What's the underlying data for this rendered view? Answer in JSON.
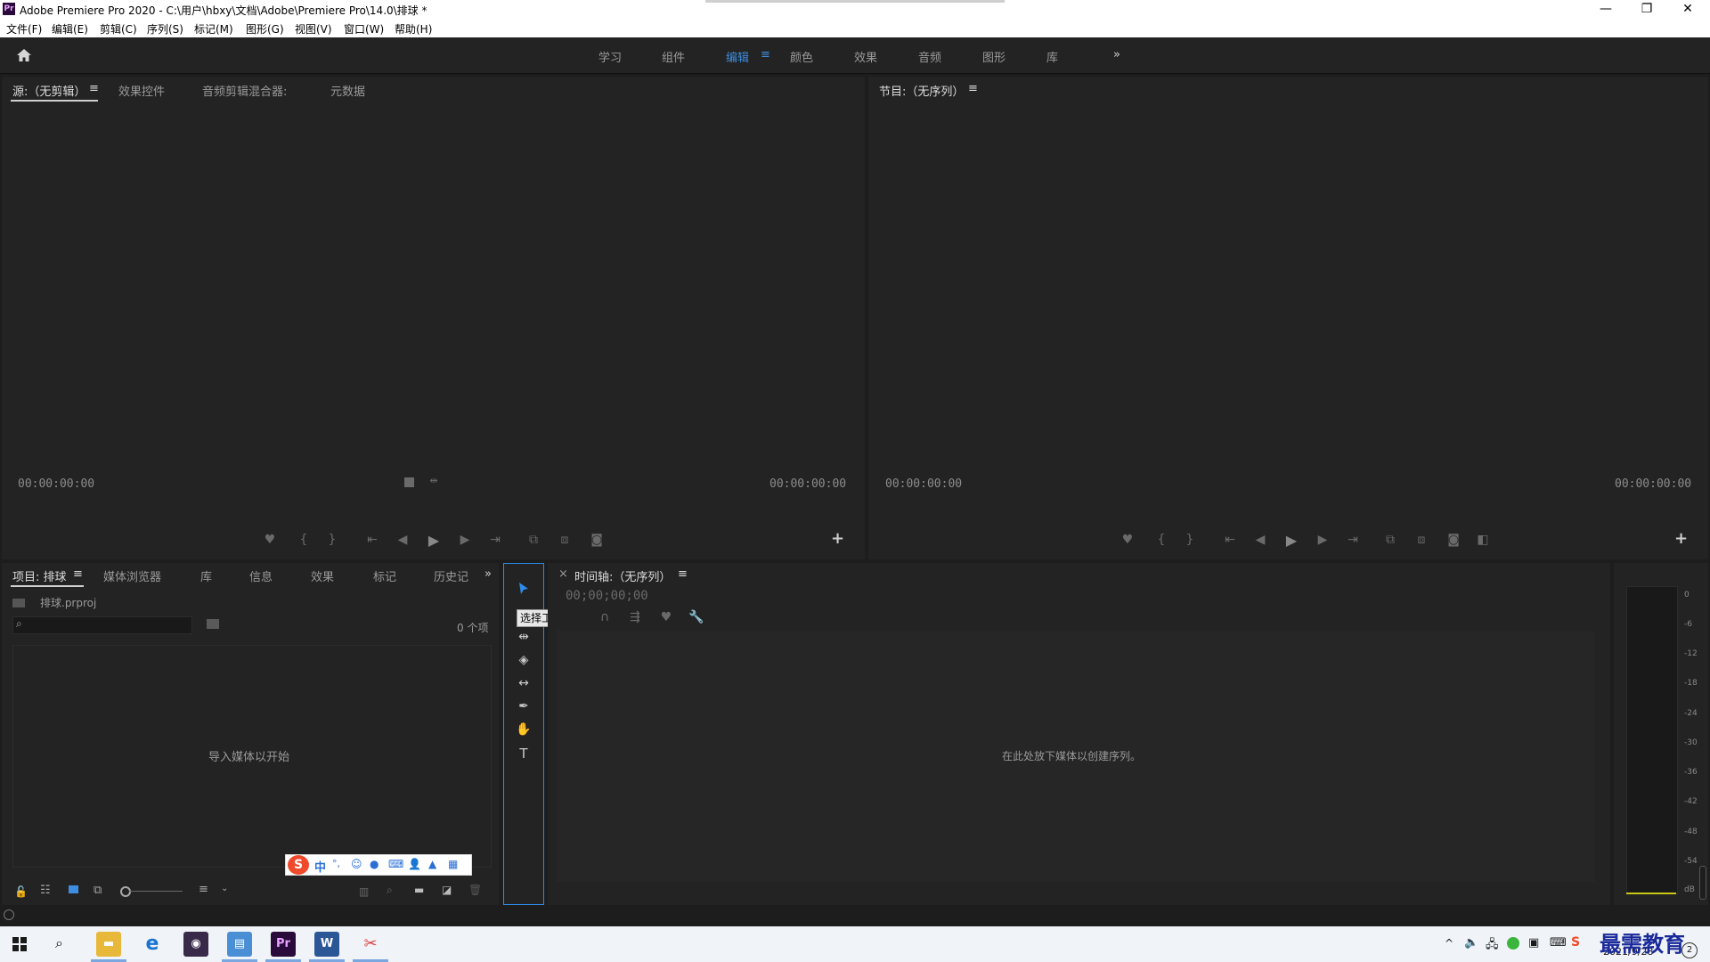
{
  "window": {
    "title": "Adobe Premiere Pro 2020 - C:\\用户\\hbxy\\文档\\Adobe\\Premiere Pro\\14.0\\排球 *",
    "logo": "Pr",
    "minimize": "—",
    "restore": "❐",
    "close": "✕"
  },
  "menu": [
    "文件(F)",
    "编辑(E)",
    "剪辑(C)",
    "序列(S)",
    "标记(M)",
    "图形(G)",
    "视图(V)",
    "窗口(W)",
    "帮助(H)"
  ],
  "workspaces": {
    "tabs": [
      "学习",
      "组件",
      "编辑",
      "颜色",
      "效果",
      "音频",
      "图形",
      "库"
    ],
    "active": "编辑",
    "menu_glyph": "≡",
    "more": "»"
  },
  "source_panel": {
    "tabs": [
      "源:（无剪辑）",
      "效果控件",
      "音频剪辑混合器:",
      "元数据"
    ],
    "menu_glyph": "≡",
    "timecode_left": "00:00:00:00",
    "timecode_right": "00:00:00:00",
    "add": "+"
  },
  "program_panel": {
    "tab": "节目:（无序列）",
    "menu_glyph": "≡",
    "timecode_left": "00:00:00:00",
    "timecode_right": "00:00:00:00",
    "add": "+"
  },
  "project_panel": {
    "tabs": [
      "项目: 排球",
      "媒体浏览器",
      "库",
      "信息",
      "效果",
      "标记",
      "历史记"
    ],
    "menu_glyph": "≡",
    "more": "»",
    "project_file": "排球.prproj",
    "item_count": "0 个项",
    "empty_message": "导入媒体以开始"
  },
  "tools": {
    "tooltip": "选择工具 (V)",
    "text_tool": "T"
  },
  "timeline_panel": {
    "close": "×",
    "tab": "时间轴:（无序列）",
    "menu_glyph": "≡",
    "timecode": "00;00;00;00",
    "empty_message": "在此处放下媒体以创建序列。"
  },
  "audio_meter": {
    "labels": [
      "0",
      "-6",
      "-12",
      "-18",
      "-24",
      "-30",
      "-36",
      "-42",
      "-48",
      "-54",
      "dB"
    ]
  },
  "ime_toolbar": {
    "logo": "S",
    "lang": "中",
    "punct": "°,"
  },
  "taskbar": {
    "date": "2021/9/28",
    "notification_count": "2",
    "watermark": "最需教育"
  },
  "colors": {
    "accent": "#3d8de0",
    "panel_bg": "#232323",
    "frame_bg": "#1d1d1d",
    "tool_highlight": "#2d8ceb",
    "premiere_purple": "#2a0a3a"
  }
}
